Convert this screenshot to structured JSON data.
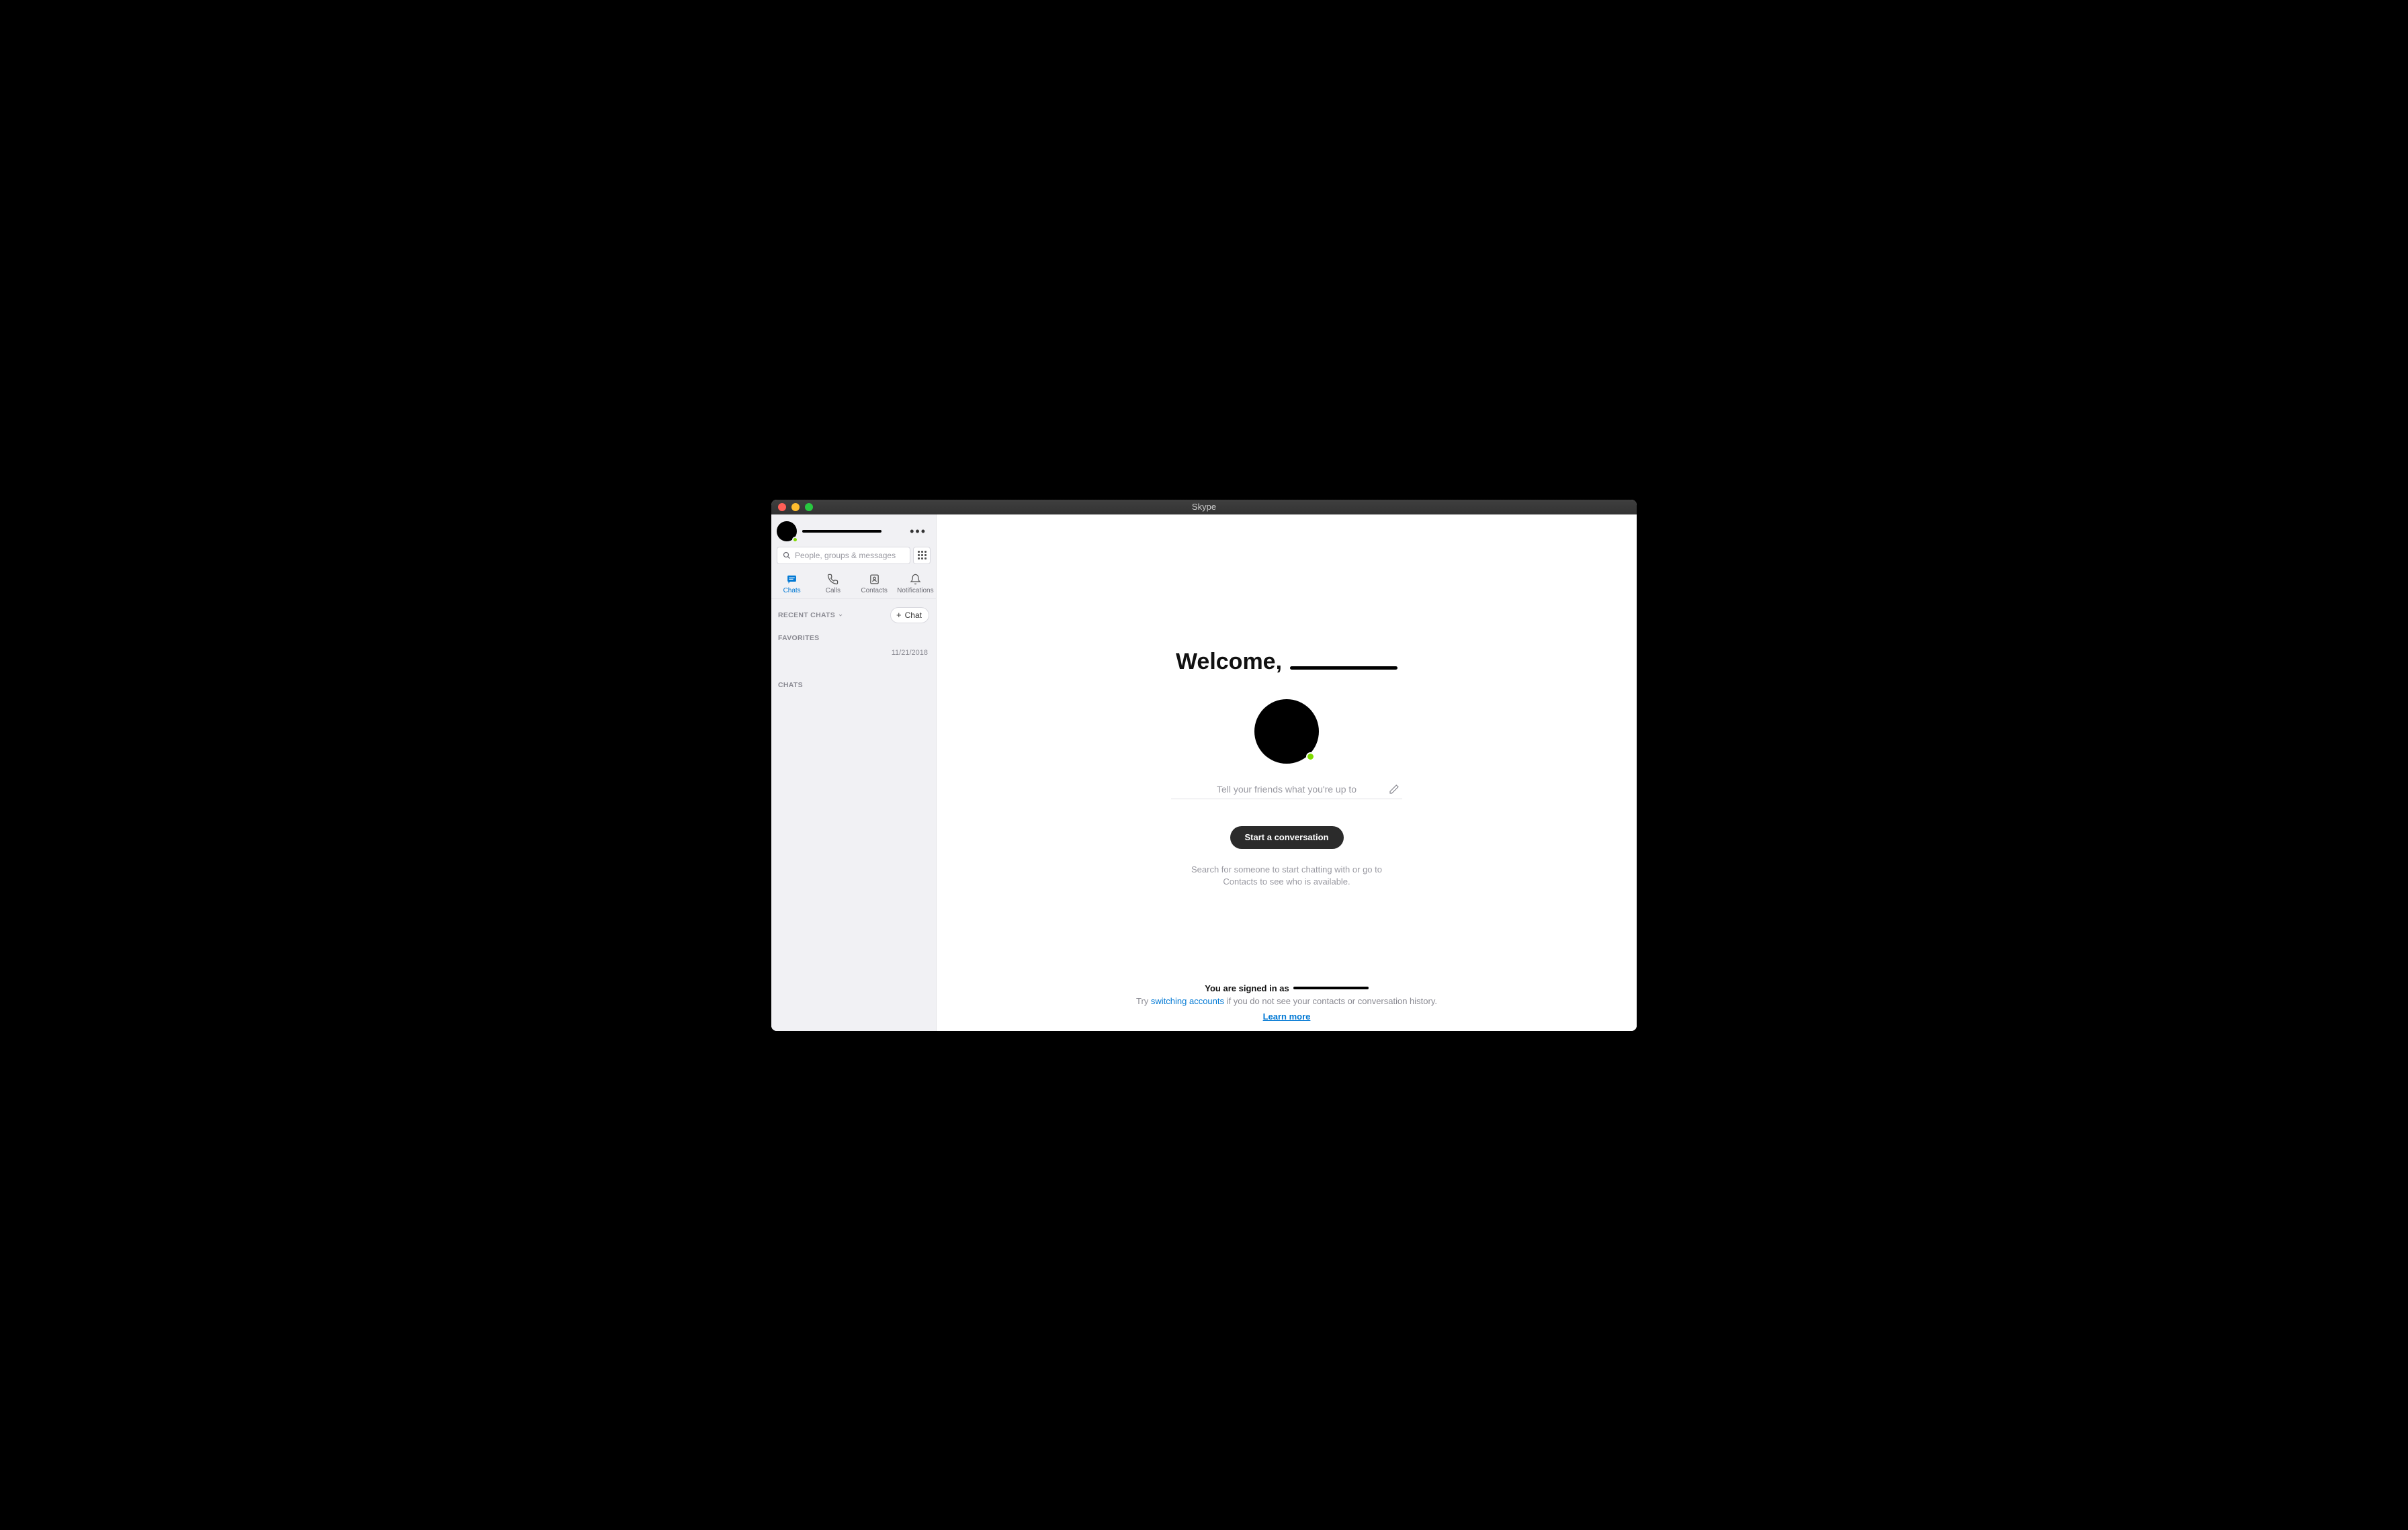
{
  "window": {
    "title": "Skype"
  },
  "sidebar": {
    "search": {
      "placeholder": "People, groups & messages"
    },
    "tabs": [
      {
        "label": "Chats"
      },
      {
        "label": "Calls"
      },
      {
        "label": "Contacts"
      },
      {
        "label": "Notifications"
      }
    ],
    "recent_chats_header": "RECENT CHATS",
    "new_chat_label": "Chat",
    "favorites_header": "FAVORITES",
    "favorite_date": "11/21/2018",
    "chats_header": "CHATS"
  },
  "main": {
    "welcome_prefix": "Welcome,",
    "mood_placeholder": "Tell your friends what you're up to",
    "start_button": "Start a conversation",
    "hint": "Search for someone to start chatting with or go to Contacts to see who is available.",
    "footer": {
      "signed_in_prefix": "You are signed in as",
      "try_prefix": "Try ",
      "switch_link": "switching accounts",
      "try_suffix": " if you do not see your contacts or conversation history.",
      "learn_more": "Learn more"
    }
  },
  "colors": {
    "accent": "#0078d4",
    "online": "#7fdb00"
  }
}
